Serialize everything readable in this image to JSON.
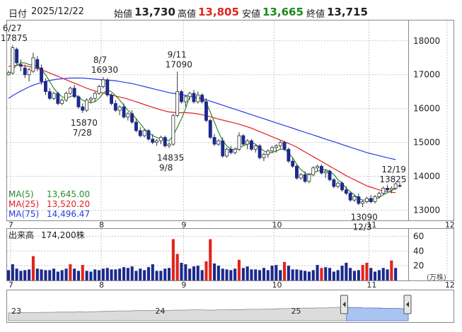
{
  "header": {
    "date_label": "日付",
    "date_value": "2025/12/22",
    "open_label": "始値",
    "open_value": "13,730",
    "high_label": "高値",
    "high_value": "13,805",
    "low_label": "安値",
    "low_value": "13,665",
    "close_label": "終値",
    "close_value": "13,715"
  },
  "colors": {
    "up": "#e0241b",
    "down": "#1c2a8c",
    "ma5": "#2b8a2b",
    "ma25": "#e02020",
    "ma75": "#2a3ce0",
    "high_value": "#e0241b",
    "low_value": "#1a8a1a",
    "volume": "#1c2a8c",
    "volume_up": "#e0241b",
    "navigator_fill": "#aac4f2",
    "grid": "#c8c8c8"
  },
  "chart_data": [
    {
      "type": "candlestick",
      "title": "",
      "ylim": [
        12700,
        18600
      ],
      "yticks": [
        13000,
        14000,
        15000,
        16000,
        17000,
        18000
      ],
      "ytick_labels": [
        "13000",
        "14000",
        "15000",
        "16000",
        "17000",
        "18000"
      ],
      "months": [
        {
          "label": "7",
          "x": 0.5
        },
        {
          "label": "8",
          "x": 22.5
        },
        {
          "label": "9",
          "x": 42.5
        },
        {
          "label": "10",
          "x": 64.5
        },
        {
          "label": "11",
          "x": 87.5
        },
        {
          "label": "12",
          "x": 106.5
        }
      ],
      "annotations": [
        {
          "date": "6/27",
          "value": "17875"
        },
        {
          "date": "8/7",
          "value": "16930"
        },
        {
          "date": "9/11",
          "value": "17090"
        },
        {
          "date": "12/19",
          "value": "13825"
        },
        {
          "date": "7/28",
          "value": "15870"
        },
        {
          "date": "9/8",
          "value": "14835"
        },
        {
          "date": "12/3",
          "value": "13090"
        }
      ],
      "ma_labels": [
        {
          "name": "MA(5)",
          "value": "13,645.00"
        },
        {
          "name": "MA(25)",
          "value": "13,520.20"
        },
        {
          "name": "MA(75)",
          "value": "14,496.47"
        }
      ],
      "ohlc": [
        [
          17000,
          17120,
          16980,
          17060
        ],
        [
          17050,
          17875,
          17000,
          17800
        ],
        [
          17750,
          17800,
          17300,
          17350
        ],
        [
          17300,
          17450,
          17100,
          17250
        ],
        [
          17200,
          17300,
          16900,
          17000
        ],
        [
          17000,
          17200,
          16800,
          17150
        ],
        [
          17100,
          17650,
          17050,
          17500
        ],
        [
          17450,
          17550,
          17100,
          17200
        ],
        [
          17200,
          17300,
          16700,
          16800
        ],
        [
          16800,
          16900,
          16400,
          16500
        ],
        [
          16500,
          16600,
          16250,
          16300
        ],
        [
          16300,
          16500,
          16250,
          16450
        ],
        [
          16450,
          16500,
          16100,
          16150
        ],
        [
          16150,
          16300,
          16100,
          16250
        ],
        [
          16250,
          16500,
          16200,
          16450
        ],
        [
          16450,
          16650,
          16400,
          16600
        ],
        [
          16600,
          16700,
          16300,
          16350
        ],
        [
          16350,
          16400,
          16000,
          16050
        ],
        [
          16050,
          16150,
          15870,
          15950
        ],
        [
          15950,
          16300,
          15900,
          16250
        ],
        [
          16250,
          16350,
          16150,
          16300
        ],
        [
          16300,
          16500,
          16200,
          16450
        ],
        [
          16450,
          16700,
          16400,
          16650
        ],
        [
          16650,
          16930,
          16600,
          16850
        ],
        [
          16850,
          16900,
          16350,
          16400
        ],
        [
          16400,
          16450,
          16100,
          16150
        ],
        [
          16150,
          16250,
          15900,
          15950
        ],
        [
          15950,
          16100,
          15800,
          16050
        ],
        [
          16050,
          16150,
          15700,
          15750
        ],
        [
          15750,
          15900,
          15650,
          15850
        ],
        [
          15850,
          15950,
          15550,
          15600
        ],
        [
          15600,
          15700,
          15300,
          15350
        ],
        [
          15350,
          15450,
          15150,
          15200
        ],
        [
          15200,
          15400,
          15150,
          15350
        ],
        [
          15350,
          15400,
          15050,
          15100
        ],
        [
          15100,
          15250,
          14950,
          15000
        ],
        [
          15000,
          15100,
          14900,
          15050
        ],
        [
          15050,
          15200,
          14950,
          15150
        ],
        [
          15150,
          15200,
          14850,
          14900
        ],
        [
          14900,
          15000,
          14835,
          14950
        ],
        [
          14950,
          15850,
          14900,
          15800
        ],
        [
          15800,
          17090,
          15750,
          16500
        ],
        [
          16500,
          16550,
          16150,
          16200
        ],
        [
          16200,
          16400,
          16050,
          16350
        ],
        [
          16350,
          16500,
          16250,
          16450
        ],
        [
          16450,
          16550,
          16150,
          16200
        ],
        [
          16200,
          16500,
          16150,
          16400
        ],
        [
          16400,
          16450,
          16150,
          16200
        ],
        [
          16200,
          16300,
          15600,
          15650
        ],
        [
          15650,
          15700,
          15100,
          15150
        ],
        [
          15150,
          15250,
          14900,
          14950
        ],
        [
          14950,
          15100,
          14900,
          15050
        ],
        [
          15050,
          15150,
          14550,
          14600
        ],
        [
          14600,
          14850,
          14550,
          14800
        ],
        [
          14800,
          14900,
          14650,
          14700
        ],
        [
          14700,
          14850,
          14650,
          14800
        ],
        [
          14800,
          15300,
          14750,
          15200
        ],
        [
          15200,
          15250,
          14900,
          14950
        ],
        [
          14950,
          15100,
          14800,
          15050
        ],
        [
          15050,
          15100,
          14750,
          14800
        ],
        [
          14800,
          14950,
          14700,
          14900
        ],
        [
          14900,
          14950,
          14500,
          14550
        ],
        [
          14550,
          14700,
          14450,
          14650
        ],
        [
          14650,
          14800,
          14550,
          14750
        ],
        [
          14750,
          14900,
          14700,
          14850
        ],
        [
          14850,
          14950,
          14700,
          14900
        ],
        [
          14900,
          15050,
          14800,
          15000
        ],
        [
          15000,
          15050,
          14750,
          14800
        ],
        [
          14800,
          14850,
          14400,
          14450
        ],
        [
          14450,
          14550,
          14250,
          14300
        ],
        [
          14300,
          14350,
          13900,
          13950
        ],
        [
          13950,
          14100,
          13900,
          14050
        ],
        [
          14050,
          14150,
          13800,
          13850
        ],
        [
          13850,
          14100,
          13800,
          14050
        ],
        [
          14050,
          14300,
          14000,
          14250
        ],
        [
          14250,
          14350,
          14150,
          14300
        ],
        [
          14300,
          14350,
          14050,
          14100
        ],
        [
          14100,
          14200,
          13950,
          14150
        ],
        [
          14150,
          14200,
          13850,
          13900
        ],
        [
          13900,
          13950,
          13650,
          13700
        ],
        [
          13700,
          13850,
          13650,
          13800
        ],
        [
          13800,
          13850,
          13550,
          13600
        ],
        [
          13600,
          13700,
          13450,
          13500
        ],
        [
          13500,
          13550,
          13250,
          13300
        ],
        [
          13300,
          13450,
          13250,
          13400
        ],
        [
          13400,
          13500,
          13150,
          13200
        ],
        [
          13200,
          13300,
          13090,
          13250
        ],
        [
          13250,
          13400,
          13200,
          13350
        ],
        [
          13350,
          13450,
          13200,
          13250
        ],
        [
          13250,
          13450,
          13200,
          13400
        ],
        [
          13400,
          13550,
          13350,
          13500
        ],
        [
          13500,
          13700,
          13450,
          13650
        ],
        [
          13650,
          13750,
          13550,
          13600
        ],
        [
          13600,
          13700,
          13500,
          13650
        ],
        [
          13650,
          13825,
          13600,
          13780
        ],
        [
          13730,
          13805,
          13665,
          13715
        ]
      ],
      "ma5": [
        17000,
        17150,
        17280,
        17350,
        17350,
        17300,
        17280,
        17260,
        17150,
        17000,
        16800,
        16600,
        16450,
        16350,
        16300,
        16350,
        16400,
        16350,
        16250,
        16200,
        16180,
        16200,
        16300,
        16450,
        16550,
        16500,
        16380,
        16250,
        16100,
        15950,
        15850,
        15700,
        15550,
        15400,
        15300,
        15200,
        15150,
        15100,
        15100,
        15050,
        15200,
        15450,
        15700,
        16000,
        16350,
        16350,
        16300,
        16300,
        16180,
        15900,
        15600,
        15300,
        15050,
        14900,
        14800,
        14800,
        14850,
        14900,
        14950,
        15000,
        14950,
        14850,
        14750,
        14700,
        14700,
        14750,
        14800,
        14800,
        14700,
        14550,
        14350,
        14200,
        14100,
        14050,
        14100,
        14150,
        14200,
        14200,
        14150,
        14050,
        13900,
        13800,
        13650,
        13550,
        13450,
        13350,
        13300,
        13300,
        13300,
        13320,
        13380,
        13450,
        13520,
        13580,
        13645
      ],
      "ma25": [
        17250,
        17260,
        17280,
        17280,
        17260,
        17240,
        17210,
        17180,
        17140,
        17100,
        17050,
        17000,
        16950,
        16900,
        16850,
        16800,
        16750,
        16700,
        16650,
        16600,
        16560,
        16520,
        16490,
        16460,
        16430,
        16400,
        16370,
        16340,
        16310,
        16280,
        16240,
        16200,
        16160,
        16120,
        16080,
        16040,
        16000,
        15960,
        15930,
        15900,
        15890,
        15880,
        15880,
        15880,
        15870,
        15860,
        15840,
        15820,
        15790,
        15760,
        15720,
        15690,
        15660,
        15630,
        15600,
        15570,
        15540,
        15500,
        15460,
        15420,
        15370,
        15320,
        15270,
        15220,
        15170,
        15120,
        15070,
        15020,
        14970,
        14920,
        14860,
        14790,
        14720,
        14650,
        14580,
        14510,
        14440,
        14370,
        14300,
        14230,
        14160,
        14090,
        14020,
        13960,
        13900,
        13840,
        13780,
        13720,
        13680,
        13640,
        13600,
        13570,
        13550,
        13530,
        13520
      ],
      "ma75": [
        16300,
        16380,
        16450,
        16520,
        16580,
        16640,
        16690,
        16730,
        16770,
        16800,
        16830,
        16850,
        16870,
        16880,
        16890,
        16900,
        16900,
        16900,
        16900,
        16890,
        16880,
        16870,
        16860,
        16850,
        16840,
        16830,
        16820,
        16800,
        16780,
        16760,
        16740,
        16710,
        16680,
        16650,
        16620,
        16590,
        16560,
        16530,
        16500,
        16470,
        16450,
        16430,
        16410,
        16390,
        16370,
        16350,
        16330,
        16300,
        16260,
        16220,
        16180,
        16140,
        16100,
        16060,
        16020,
        15980,
        15940,
        15900,
        15860,
        15820,
        15780,
        15740,
        15700,
        15660,
        15620,
        15580,
        15540,
        15500,
        15460,
        15420,
        15380,
        15340,
        15300,
        15260,
        15220,
        15180,
        15140,
        15100,
        15060,
        15020,
        14980,
        14940,
        14900,
        14860,
        14820,
        14780,
        14740,
        14700,
        14670,
        14640,
        14610,
        14580,
        14550,
        14520,
        14496
      ]
    },
    {
      "type": "bar",
      "title": "出来高",
      "latest_label": "174,200株",
      "ylim": [
        0,
        70
      ],
      "yticks": [
        20,
        40,
        60
      ],
      "ytick_labels": [
        "20",
        "40",
        "60"
      ],
      "unit": "(万株)",
      "values": [
        14,
        22,
        16,
        13,
        14,
        15,
        33,
        16,
        15,
        14,
        14,
        16,
        12,
        14,
        16,
        22,
        16,
        13,
        21,
        13,
        12,
        15,
        14,
        16,
        17,
        15,
        15,
        16,
        18,
        17,
        19,
        13,
        16,
        14,
        18,
        22,
        13,
        13,
        16,
        17,
        56,
        36,
        24,
        22,
        16,
        19,
        20,
        14,
        26,
        56,
        23,
        20,
        16,
        15,
        14,
        16,
        28,
        17,
        19,
        15,
        15,
        14,
        17,
        14,
        20,
        21,
        14,
        25,
        20,
        15,
        15,
        14,
        13,
        12,
        14,
        21,
        17,
        18,
        17,
        12,
        14,
        20,
        24,
        17,
        13,
        14,
        21,
        24,
        17,
        12,
        14,
        17,
        15,
        27,
        17
      ],
      "up_bars": [
        6,
        15,
        18,
        40,
        41,
        48,
        49,
        56,
        67,
        76,
        86,
        87,
        93
      ]
    },
    {
      "type": "area",
      "title": "",
      "labels": [
        "23",
        "24",
        "25"
      ],
      "values": [
        9,
        9,
        10,
        10,
        10,
        10,
        11,
        11,
        11,
        12,
        12,
        12,
        12,
        13,
        12,
        13,
        14,
        15,
        15,
        16,
        17,
        17,
        17,
        18,
        18,
        18,
        18,
        19,
        19,
        19,
        20,
        20,
        20,
        21,
        21,
        21,
        20,
        20,
        21,
        21,
        22,
        22,
        22,
        23,
        23,
        23,
        24,
        24,
        25,
        26,
        26,
        27,
        27,
        28,
        28,
        28,
        29,
        29,
        30,
        31,
        31,
        31,
        30,
        30,
        29,
        29,
        28,
        28,
        27,
        27,
        27,
        26,
        26
      ],
      "selected_from": 0.845
    }
  ]
}
